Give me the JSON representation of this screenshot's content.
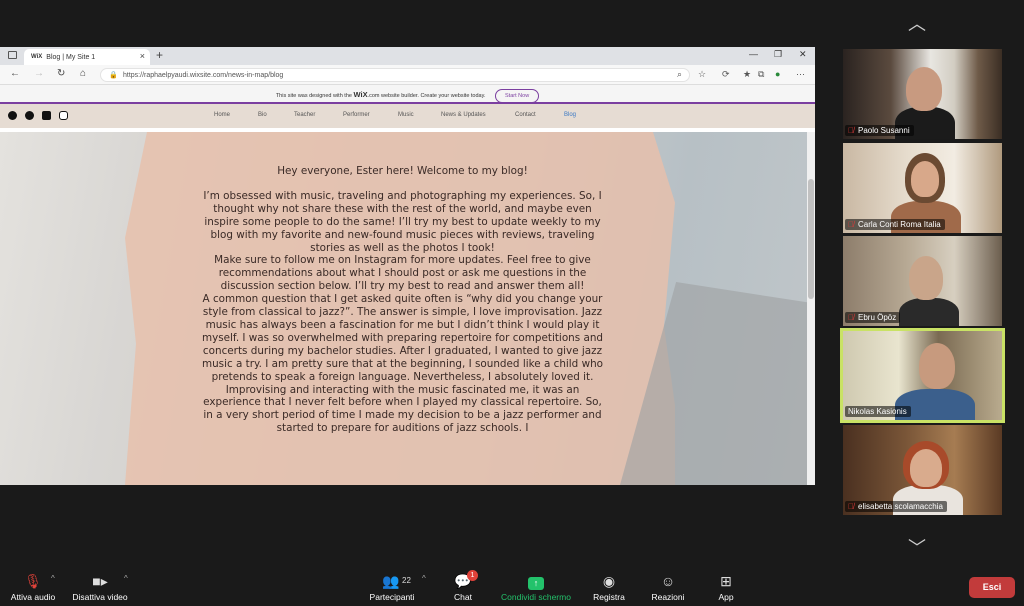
{
  "browser": {
    "tab_title": "Blog | My Site 1",
    "tab_logo": "WiX",
    "new_tab": "+",
    "url": "https://raphaelpyaudi.wixsite.com/news-in-map/blog",
    "wix_banner": {
      "text_before": "This site was designed with the",
      "brand": "WiX",
      "text_after": ".com website builder. Create your website today.",
      "button": "Start Now"
    }
  },
  "site": {
    "social_icons": [
      "tiktok-icon",
      "spotify-icon",
      "youtube-icon",
      "instagram-icon"
    ],
    "nav": [
      "Home",
      "Bio",
      "Teacher",
      "Performer",
      "Music",
      "News & Updates",
      "Contact",
      "Blog"
    ],
    "active_nav": "Blog",
    "blog": {
      "greeting": "Hey everyone, Ester here! Welcome to my blog!",
      "para1": "I’m obsessed with music, traveling and photographing my experiences. So, I thought why not share these with the rest of the world, and maybe even inspire some people to do the same! I’ll try my best to update weekly to my blog with my favorite and new-found music pieces with reviews, traveling stories as well as the photos I took!",
      "para2": "Make sure to follow me on Instagram for more updates. Feel free to give recommendations about what I should post or ask me questions in the discussion section below. I’ll try my best to read and answer them all!",
      "para3": "A common question that I get asked quite often is “why did you change your style from classical to jazz?”. The answer is simple, I love improvisation. Jazz music has always been a fascination for me but I didn’t think I would play it myself. I was so overwhelmed with preparing repertoire for competitions and concerts during my bachelor studies. After I graduated, I wanted to give jazz music a try. I am pretty sure that at the beginning, I sounded like a child who pretends to speak a foreign language. Nevertheless, I absolutely loved it. Improvising and interacting with the music fascinated me, it was an experience that I never felt before when I played my classical repertoire. So, in a very short period of time I made my decision to be a jazz performer and started to prepare for auditions of jazz schools. I"
    }
  },
  "participants": [
    {
      "name": "Paolo Susanni",
      "muted": true
    },
    {
      "name": "Carla Conti Roma Italia",
      "muted": true
    },
    {
      "name": "Ebru Öpöz",
      "muted": true
    },
    {
      "name": "Nikolas Kasionis",
      "muted": false,
      "active_speaker": true
    },
    {
      "name": "elisabetta scolamacchia",
      "muted": true
    }
  ],
  "controls": {
    "audio": "Attiva audio",
    "video": "Disattiva video",
    "participants": "Partecipanti",
    "participants_count": "22",
    "chat": "Chat",
    "chat_badge": "1",
    "share": "Condividi schermo",
    "record": "Registra",
    "reactions": "Reazioni",
    "apps": "App",
    "leave": "Esci"
  },
  "colors": {
    "share_green": "#23c26b",
    "leave_red": "#c23b3b",
    "active_speaker_border": "#c9e265",
    "wix_purple": "#7b3fa0",
    "active_nav_blue": "#3a78c4"
  }
}
